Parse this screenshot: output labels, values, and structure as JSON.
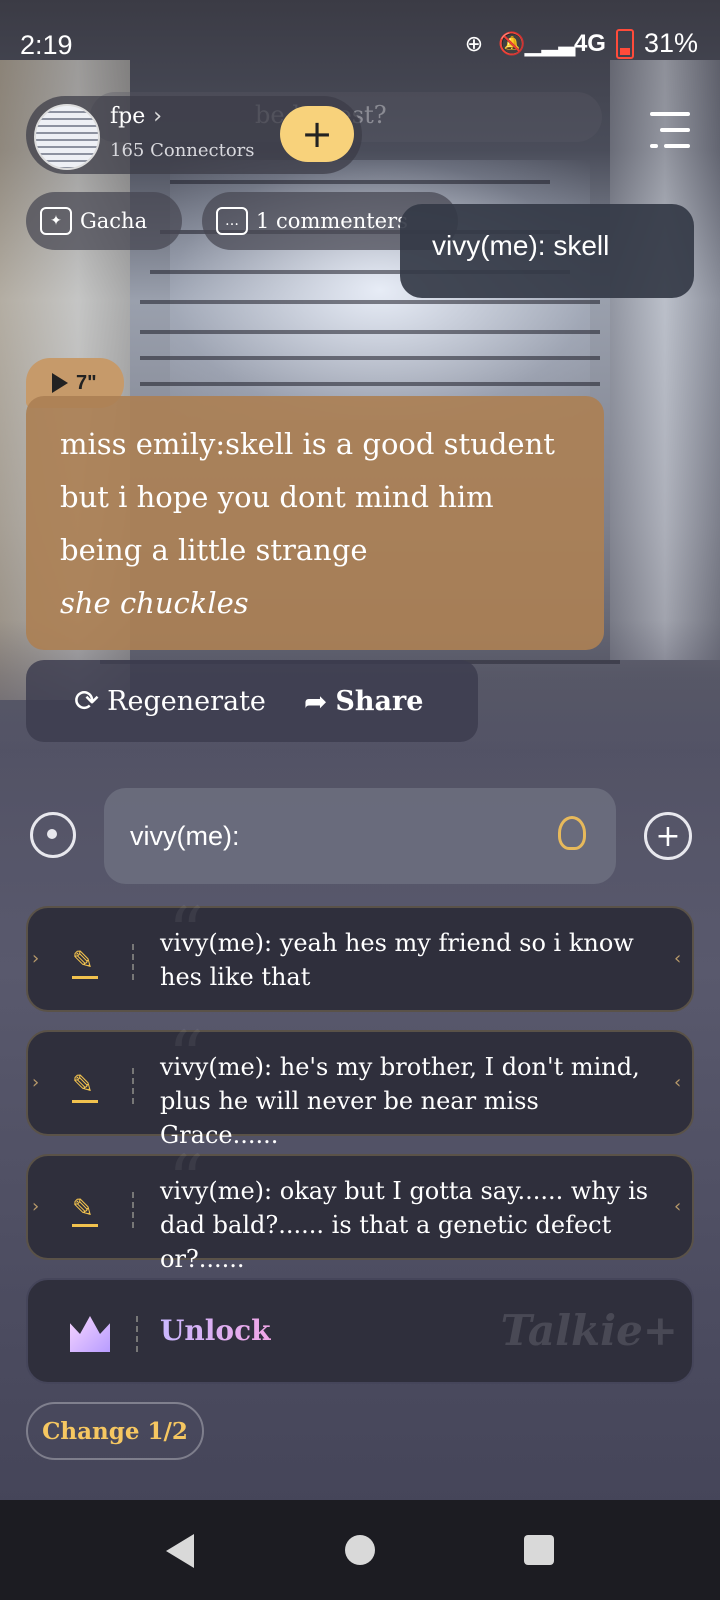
{
  "status_bar": {
    "time": "2:19",
    "network": "4G",
    "battery": "31%"
  },
  "header": {
    "character_name": "fpe",
    "connectors": "165 Connectors",
    "ghost_text": "be honest?"
  },
  "chips": {
    "gacha": "Gacha",
    "commenters": "1 commenters"
  },
  "chat": {
    "user_message": "vivy(me): skell",
    "voice_duration": "7\"",
    "ai_message": "miss emily:skell is a good student but i hope you dont mind him being a little strange",
    "ai_action": "she chuckles"
  },
  "actions": {
    "regenerate": "Regenerate",
    "share": "Share"
  },
  "input": {
    "value": "vivy(me):"
  },
  "suggestions": [
    {
      "text": "vivy(me): yeah hes my friend so i know hes like that"
    },
    {
      "text": "vivy(me): he's my brother, I don't mind, plus he will never be near miss Grace......"
    },
    {
      "text": "vivy(me): okay but I gotta say...... why is dad bald?...... is that a genetic defect or?......"
    }
  ],
  "unlock": {
    "label": "Unlock",
    "brand": "Talkie+"
  },
  "change_label": "Change 1/2",
  "colors": {
    "accent_yellow": "#f8d27b",
    "ai_bubble": "#ab8055",
    "card_bg": "#2f2f3c"
  }
}
